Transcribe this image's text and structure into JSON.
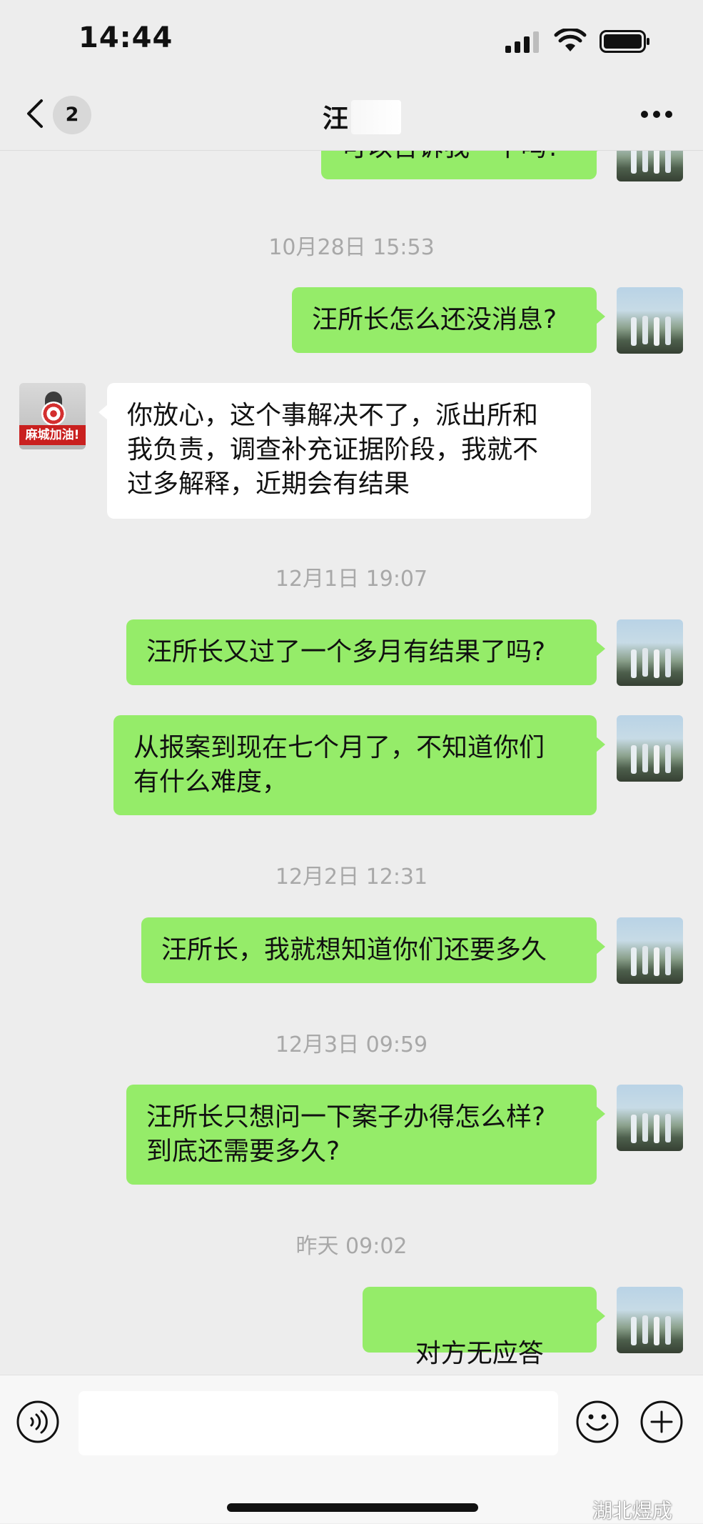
{
  "status_bar": {
    "time": "14:44"
  },
  "header": {
    "unread_count": "2",
    "title": "汪"
  },
  "messages": [
    {
      "side": "self",
      "text": "可以告诉我一下吗?"
    },
    {
      "type": "time",
      "text": "10月28日 15:53"
    },
    {
      "side": "self",
      "text": "汪所长怎么还没消息?"
    },
    {
      "side": "other",
      "text": "你放心，这个事解决不了，派出所和\n我负责，调查补充证据阶段，我就不\n过多解释，近期会有结果",
      "avatar_label": "麻城加油!"
    },
    {
      "type": "time",
      "text": "12月1日 19:07"
    },
    {
      "side": "self",
      "text": "汪所长又过了一个多月有结果了吗?"
    },
    {
      "side": "self",
      "text": "从报案到现在七个月了，不知道你们\n有什么难度，"
    },
    {
      "type": "time",
      "text": "12月2日 12:31"
    },
    {
      "side": "self",
      "text": "汪所长，我就想知道你们还要多久"
    },
    {
      "type": "time",
      "text": "12月3日 09:59"
    },
    {
      "side": "self",
      "text": "汪所长只想问一下案子办得怎么样?\n到底还需要多久?"
    },
    {
      "type": "time",
      "text": "昨天 09:02"
    },
    {
      "side": "self",
      "text": "对方无应答",
      "icon": "phone-hangup-icon"
    }
  ],
  "input": {
    "value": "",
    "placeholder": ""
  },
  "watermark": "湖北煜成",
  "colors": {
    "background": "#ededed",
    "self_bubble": "#95ec69",
    "other_bubble": "#ffffff",
    "timestamp": "#a8a8a8"
  }
}
